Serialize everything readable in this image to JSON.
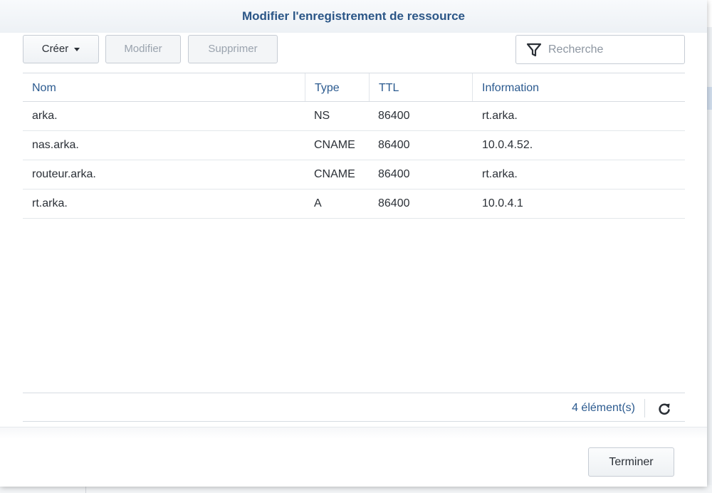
{
  "dialog": {
    "title": "Modifier l'enregistrement de ressource"
  },
  "toolbar": {
    "create_label": "Créer",
    "modify_label": "Modifier",
    "delete_label": "Supprimer"
  },
  "search": {
    "placeholder": "Recherche",
    "icon": "filter-icon"
  },
  "table": {
    "columns": [
      "Nom",
      "Type",
      "TTL",
      "Information"
    ],
    "rows": [
      {
        "name": "arka.",
        "type": "NS",
        "ttl": "86400",
        "info": "rt.arka."
      },
      {
        "name": "nas.arka.",
        "type": "CNAME",
        "ttl": "86400",
        "info": "10.0.4.52."
      },
      {
        "name": "routeur.arka.",
        "type": "CNAME",
        "ttl": "86400",
        "info": "rt.arka."
      },
      {
        "name": "rt.arka.",
        "type": "A",
        "ttl": "86400",
        "info": "10.0.4.1"
      }
    ]
  },
  "footer": {
    "count_label": "4 élément(s)",
    "refresh_icon": "refresh-icon",
    "finish_label": "Terminer"
  },
  "colors": {
    "title": "#2b5687",
    "header_text": "#2b5a8f",
    "disabled_text": "#9aa3ae"
  }
}
